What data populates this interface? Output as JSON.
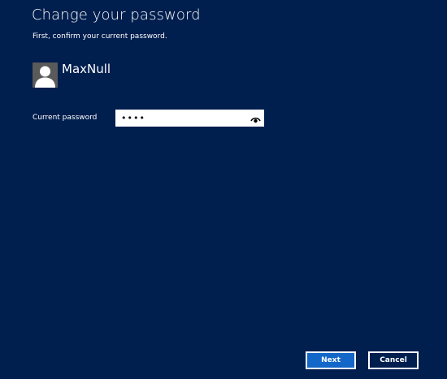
{
  "header": {
    "title": "Change your password",
    "subtitle": "First, confirm your current password."
  },
  "user": {
    "name": "MaxNull",
    "avatar_icon": "user-silhouette-icon"
  },
  "form": {
    "current_password_label": "Current password",
    "current_password_value": "••••",
    "reveal_icon": "eye-icon"
  },
  "buttons": {
    "next_label": "Next",
    "cancel_label": "Cancel"
  },
  "colors": {
    "background": "#001e4e",
    "primary_button": "#1367c8",
    "text": "#ffffff"
  }
}
